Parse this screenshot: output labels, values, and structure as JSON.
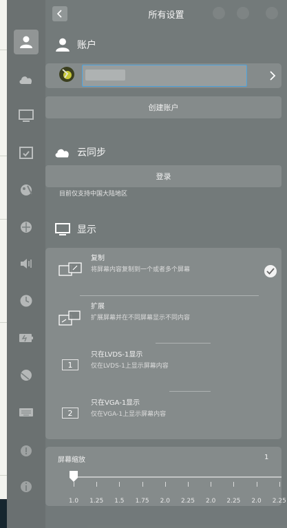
{
  "header": {
    "title": "所有设置"
  },
  "account": {
    "section_label": "账户",
    "username_value": "",
    "create_button": "创建账户"
  },
  "cloud": {
    "section_label": "云同步",
    "login_button": "登录",
    "note": "目前仅支持中国大陆地区"
  },
  "display": {
    "section_label": "显示",
    "modes": [
      {
        "title": "复制",
        "desc": "将屏幕内容复制到一个或者多个屏幕",
        "selected": true
      },
      {
        "title": "扩展",
        "desc": "扩展屏幕并在不同屏幕显示不同内容",
        "selected": false
      },
      {
        "title": "只在LVDS-1显示",
        "desc": "仅在LVDS-1上显示屏幕内容",
        "badge": "1",
        "selected": false
      },
      {
        "title": "只在VGA-1显示",
        "desc": "仅在VGA-1上显示屏幕内容",
        "badge": "2",
        "selected": false
      }
    ],
    "scale": {
      "label": "屏幕缩放",
      "value": "1",
      "current_fraction": 0,
      "tick_labels": [
        "1.0",
        "1.25",
        "1.5",
        "1.75",
        "2.0",
        "2.25",
        "2.0",
        "2.25",
        "2.0",
        "2.25"
      ]
    }
  },
  "sidebar": {
    "items": [
      {
        "icon": "account-icon",
        "active": true
      },
      {
        "icon": "cloud-icon"
      },
      {
        "icon": "display-icon"
      },
      {
        "icon": "default-apps-icon"
      },
      {
        "icon": "personalization-icon"
      },
      {
        "icon": "network-icon"
      },
      {
        "icon": "sound-icon"
      },
      {
        "icon": "time-icon"
      },
      {
        "icon": "power-icon"
      },
      {
        "icon": "mouse-icon"
      },
      {
        "icon": "keyboard-icon"
      },
      {
        "icon": "update-icon"
      },
      {
        "icon": "info-icon"
      }
    ]
  },
  "colors": {
    "accent": "#4aa3df",
    "panel": "#7a8080"
  }
}
